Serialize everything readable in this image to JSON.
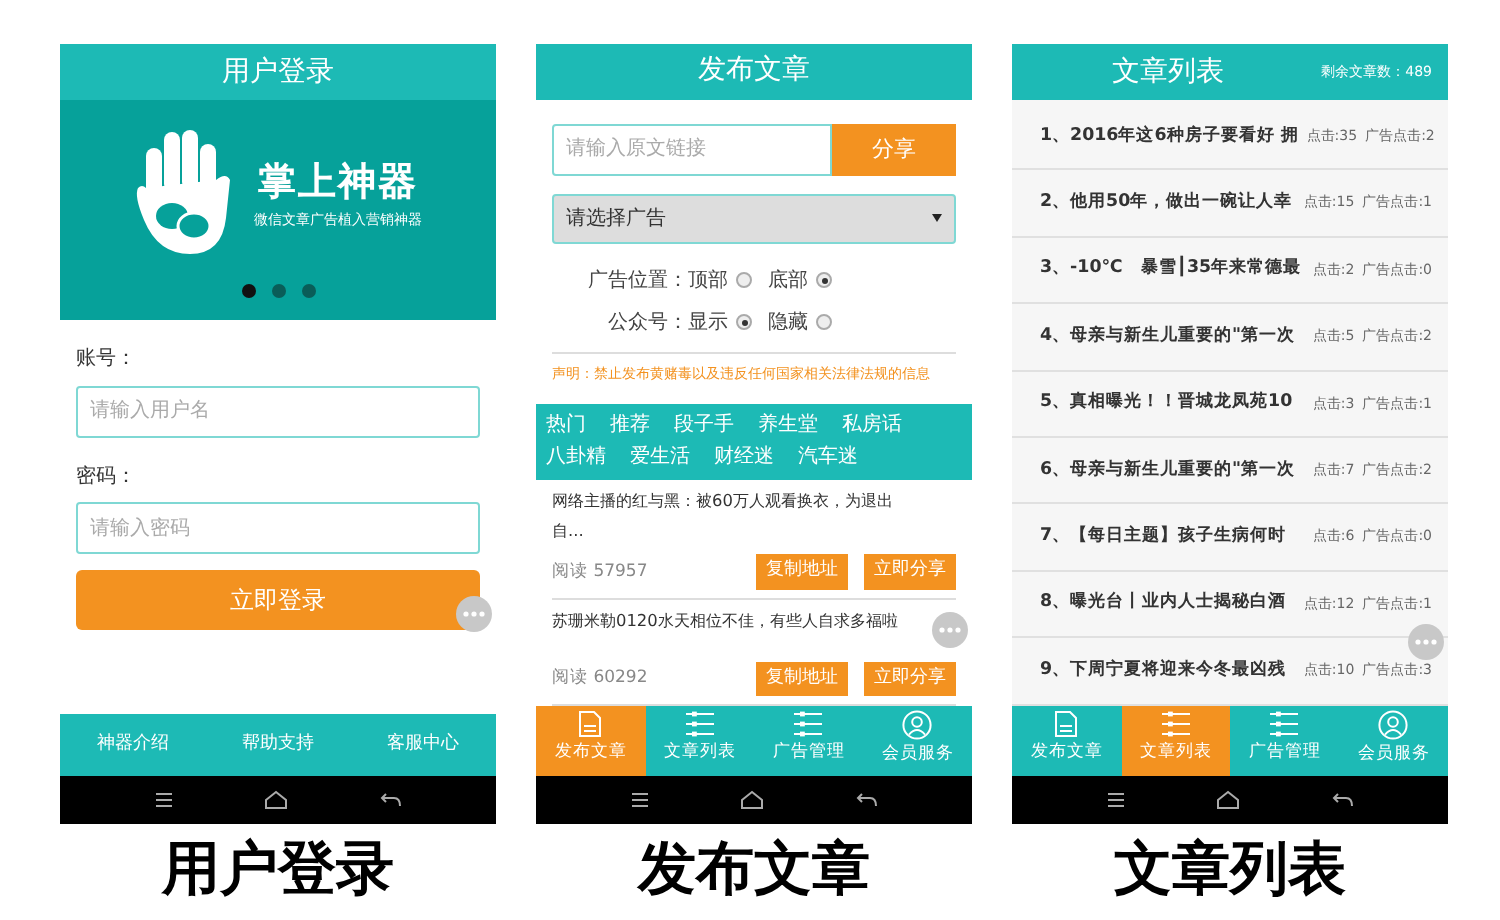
{
  "screens": [
    {
      "kind": "login",
      "title": "用户登录",
      "banner": {
        "brand": "掌上神器",
        "tagline": "微信文章广告植入营销神器",
        "dots": [
          {
            "selected": true
          },
          {
            "selected": false
          },
          {
            "selected": false
          }
        ]
      },
      "fields": [
        {
          "label": "账号：",
          "placeholder": "请输入用户名"
        },
        {
          "label": "密码：",
          "placeholder": "请输入密码"
        }
      ],
      "submit": "立即登录",
      "footer_links": [
        "神器介绍",
        "帮助支持",
        "客服中心"
      ],
      "caption": "用户登录"
    },
    {
      "kind": "publish",
      "title": "发布文章",
      "link_placeholder": "请输入原文链接",
      "share_button": "分享",
      "ad_select": "请选择广告",
      "options": [
        {
          "label": "广告位置：",
          "choices": [
            {
              "label": "顶部",
              "selected": false
            },
            {
              "label": "底部",
              "selected": true
            }
          ]
        },
        {
          "label": "公众号：",
          "choices": [
            {
              "label": "显示",
              "selected": true
            },
            {
              "label": "隐藏",
              "selected": false
            }
          ]
        }
      ],
      "notice": "声明：禁止发布黄赌毒以及违反任何国家相关法律法规的信息",
      "categories": [
        "热门",
        "推荐",
        "段子手",
        "养生堂",
        "私房话",
        "八卦精",
        "爱生活",
        "财经迷",
        "汽车迷"
      ],
      "articles": [
        {
          "title": "网络主播的红与黑：被60万人观看换衣，为退出自...",
          "reads": "阅读 57957",
          "actions": [
            "复制地址",
            "立即分享"
          ]
        },
        {
          "title": "苏珊米勒0120水天相位不佳，有些人自求多福啦",
          "reads": "阅读 60292",
          "actions": [
            "复制地址",
            "立即分享"
          ]
        }
      ],
      "nav": [
        {
          "label": "发布文章",
          "kind": "doc",
          "selected": true
        },
        {
          "label": "文章列表",
          "kind": "list",
          "selected": false
        },
        {
          "label": "广告管理",
          "kind": "list",
          "selected": false
        },
        {
          "label": "会员服务",
          "kind": "user",
          "selected": false
        }
      ],
      "caption": "发布文章"
    },
    {
      "kind": "list",
      "title": "文章列表",
      "remaining": "剩余文章数：489",
      "articles": [
        {
          "title": "1、2016年这6种房子要看好 拥",
          "clicks": "点击:35",
          "ad_clicks": "广告点击:2"
        },
        {
          "title": "2、他用50年，做出一碗让人幸",
          "clicks": "点击:15",
          "ad_clicks": "广告点击:1"
        },
        {
          "title": "3、-10℃　暴雪┃35年来常德最",
          "clicks": "点击:2",
          "ad_clicks": "广告点击:0"
        },
        {
          "title": "4、母亲与新生儿重要的\"第一次",
          "clicks": "点击:5",
          "ad_clicks": "广告点击:2"
        },
        {
          "title": "5、真相曝光！！晋城龙凤苑10",
          "clicks": "点击:3",
          "ad_clicks": "广告点击:1"
        },
        {
          "title": "6、母亲与新生儿重要的\"第一次",
          "clicks": "点击:7",
          "ad_clicks": "广告点击:2"
        },
        {
          "title": "7、【每日主题】孩子生病何时",
          "clicks": "点击:6",
          "ad_clicks": "广告点击:0"
        },
        {
          "title": "8、曝光台丨业内人士揭秘白酒",
          "clicks": "点击:12",
          "ad_clicks": "广告点击:1"
        },
        {
          "title": "9、下周宁夏将迎来今冬最凶残",
          "clicks": "点击:10",
          "ad_clicks": "广告点击:3"
        }
      ],
      "nav": [
        {
          "label": "发布文章",
          "kind": "doc",
          "selected": false
        },
        {
          "label": "文章列表",
          "kind": "list",
          "selected": true
        },
        {
          "label": "广告管理",
          "kind": "list",
          "selected": false
        },
        {
          "label": "会员服务",
          "kind": "user",
          "selected": false
        }
      ],
      "caption": "文章列表"
    }
  ]
}
